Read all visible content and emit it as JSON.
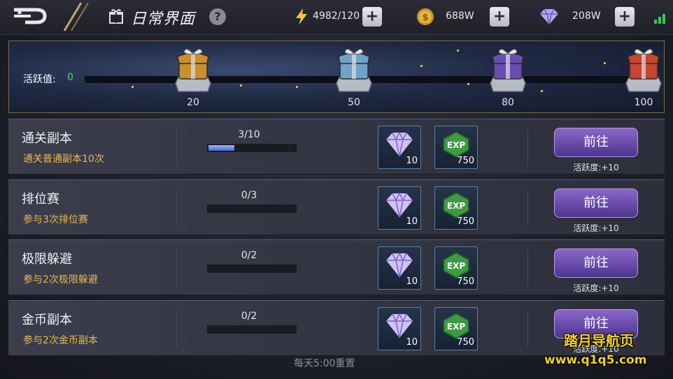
{
  "header": {
    "title": "日常界面",
    "help": "?",
    "energy": "4982/120",
    "gold": "688W",
    "diamonds": "208W",
    "plus": "+"
  },
  "activity": {
    "label": "活跃值:",
    "value": "0",
    "milestones": [
      {
        "points": "20",
        "color": "#c8902a"
      },
      {
        "points": "50",
        "color": "#6fa3c8"
      },
      {
        "points": "80",
        "color": "#6a4db0"
      },
      {
        "points": "100",
        "color": "#c8452e"
      }
    ]
  },
  "tasks": [
    {
      "name": "通关副本",
      "desc": "通关普通副本10次",
      "progress": "3/10",
      "fraction": 0.3,
      "rewards": [
        {
          "icon": "diamond-icon",
          "count": "10"
        },
        {
          "icon": "exp-icon",
          "count": "750"
        }
      ],
      "button": "前往",
      "bonus": "活跃度:+10"
    },
    {
      "name": "排位赛",
      "desc": "参与3次排位赛",
      "progress": "0/3",
      "fraction": 0,
      "rewards": [
        {
          "icon": "diamond-icon",
          "count": "10"
        },
        {
          "icon": "exp-icon",
          "count": "750"
        }
      ],
      "button": "前往",
      "bonus": "活跃度:+10"
    },
    {
      "name": "极限躲避",
      "desc": "参与2次极限躲避",
      "progress": "0/2",
      "fraction": 0,
      "rewards": [
        {
          "icon": "diamond-icon",
          "count": "10"
        },
        {
          "icon": "exp-icon",
          "count": "750"
        }
      ],
      "button": "前往",
      "bonus": "活跃度:+10"
    },
    {
      "name": "金币副本",
      "desc": "参与2次金币副本",
      "progress": "0/2",
      "fraction": 0,
      "rewards": [
        {
          "icon": "diamond-icon",
          "count": "10"
        },
        {
          "icon": "exp-icon",
          "count": "750"
        }
      ],
      "button": "前往",
      "bonus": "活跃度:+10"
    }
  ],
  "footer": {
    "reset": "每天5:00重置"
  },
  "watermark": {
    "line1": "踏月导航页",
    "line2": "www.q1q5.com"
  },
  "exp_label": "EXP"
}
